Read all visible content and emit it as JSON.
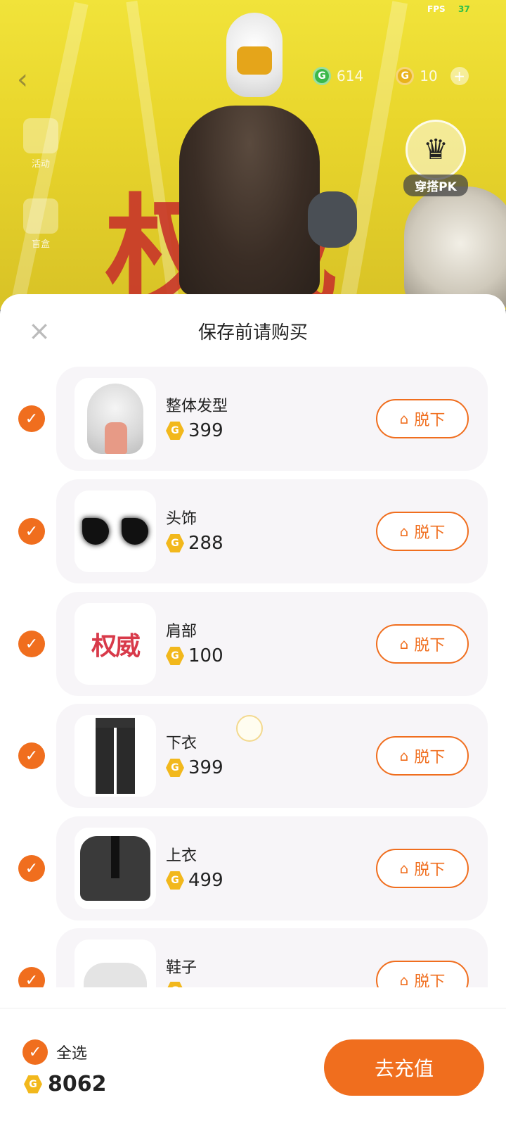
{
  "status": {
    "fps_label": "FPS",
    "fps_value": "37"
  },
  "hud": {
    "green_coin_amount": "614",
    "gold_coin_amount": "10",
    "side_menu": [
      "活动",
      "盲盒"
    ],
    "pk_label": "穿搭PK"
  },
  "background_calligraphy": "权威",
  "sheet": {
    "title": "保存前请购买",
    "remove_label": "脱下",
    "items": [
      {
        "name": "整体发型",
        "price": "399",
        "thumb": "hair"
      },
      {
        "name": "头饰",
        "price": "288",
        "thumb": "ears"
      },
      {
        "name": "肩部",
        "price": "100",
        "thumb": "shoulder",
        "thumb_text": "权威"
      },
      {
        "name": "下衣",
        "price": "399",
        "thumb": "pants"
      },
      {
        "name": "上衣",
        "price": "499",
        "thumb": "sweater"
      },
      {
        "name": "鞋子",
        "price": "",
        "thumb": "shoe"
      }
    ]
  },
  "footer": {
    "select_all_label": "全选",
    "total": "8062",
    "recharge_label": "去充值"
  },
  "colors": {
    "accent": "#f06e1e",
    "coin": "#f2b81c",
    "card_bg": "#f7f5f8"
  }
}
